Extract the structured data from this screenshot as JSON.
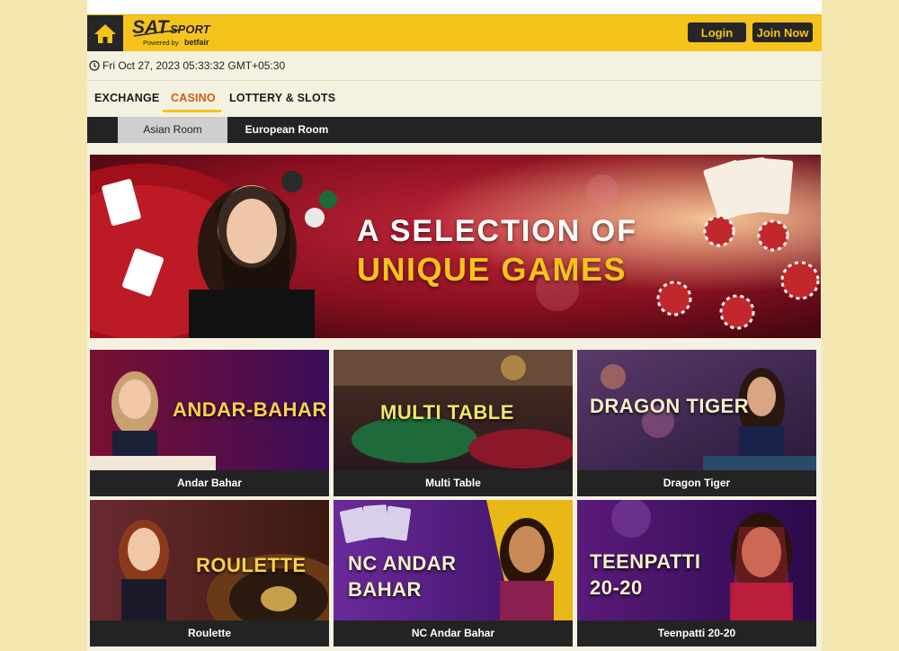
{
  "header": {
    "logo_text": "SATSPORT",
    "logo_sub": "Powered by",
    "logo_partner": "betfair",
    "login_label": "Login",
    "join_label": "Join Now"
  },
  "datetime": "Fri Oct 27, 2023 05:33:32 GMT+05:30",
  "nav": {
    "tabs": [
      {
        "label": "EXCHANGE"
      },
      {
        "label": "CASINO",
        "active": true
      },
      {
        "label": "LOTTERY & SLOTS"
      }
    ]
  },
  "subnav": {
    "tabs": [
      {
        "label": "Asian Room",
        "active": true
      },
      {
        "label": "European Room"
      }
    ]
  },
  "banner": {
    "line1": "A SELECTION OF",
    "line2": "UNIQUE GAMES"
  },
  "games": [
    {
      "title": "ANDAR-BAHAR",
      "label": "Andar Bahar"
    },
    {
      "title": "MULTI TABLE",
      "label": "Multi Table"
    },
    {
      "title": "DRAGON TIGER",
      "label": "Dragon Tiger"
    },
    {
      "title": "ROULETTE",
      "label": "Roulette"
    },
    {
      "title": "NC ANDAR BAHAR",
      "title_line1": "NC ANDAR",
      "title_line2": "BAHAR",
      "label": "NC Andar Bahar"
    },
    {
      "title": "TEENPATTI 20-20",
      "title_line1": "TEENPATTI",
      "title_line2": "20-20",
      "label": "Teenpatti 20-20"
    }
  ],
  "colors": {
    "brand_yellow": "#f6c31c",
    "dark": "#232323",
    "active_tab": "#d65a0f",
    "page_bg": "#f4e7b0"
  }
}
